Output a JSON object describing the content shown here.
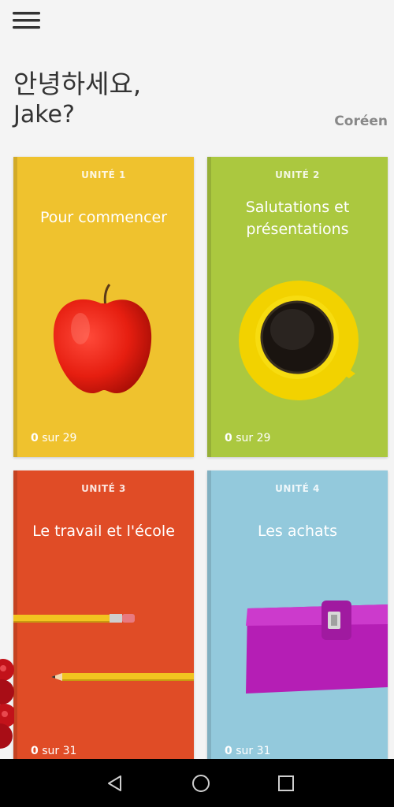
{
  "greeting": {
    "line1": "안녕하세요,",
    "line2": "Jake?"
  },
  "language": "Coréen",
  "units": [
    {
      "unit_label": "UNITÉ 1",
      "title": "Pour commencer",
      "done": "0",
      "total_text": " sur 29",
      "color": "#efc22e",
      "art": "apple"
    },
    {
      "unit_label": "UNITÉ 2",
      "title": "Salutations et présentations",
      "done": "0",
      "total_text": " sur 29",
      "color": "#abc83f",
      "art": "coffee-cup"
    },
    {
      "unit_label": "UNITÉ 3",
      "title": "Le travail et l'école",
      "done": "0",
      "total_text": " sur 31",
      "color": "#e04c26",
      "art": "pencils"
    },
    {
      "unit_label": "UNITÉ 4",
      "title": "Les achats",
      "done": "0",
      "total_text": " sur 31",
      "color": "#93c9dc",
      "art": "wallet"
    }
  ],
  "icons": {
    "menu": "hamburger-menu-icon",
    "nav_back": "triangle-back-icon",
    "nav_home": "circle-home-icon",
    "nav_recent": "square-recents-icon"
  }
}
